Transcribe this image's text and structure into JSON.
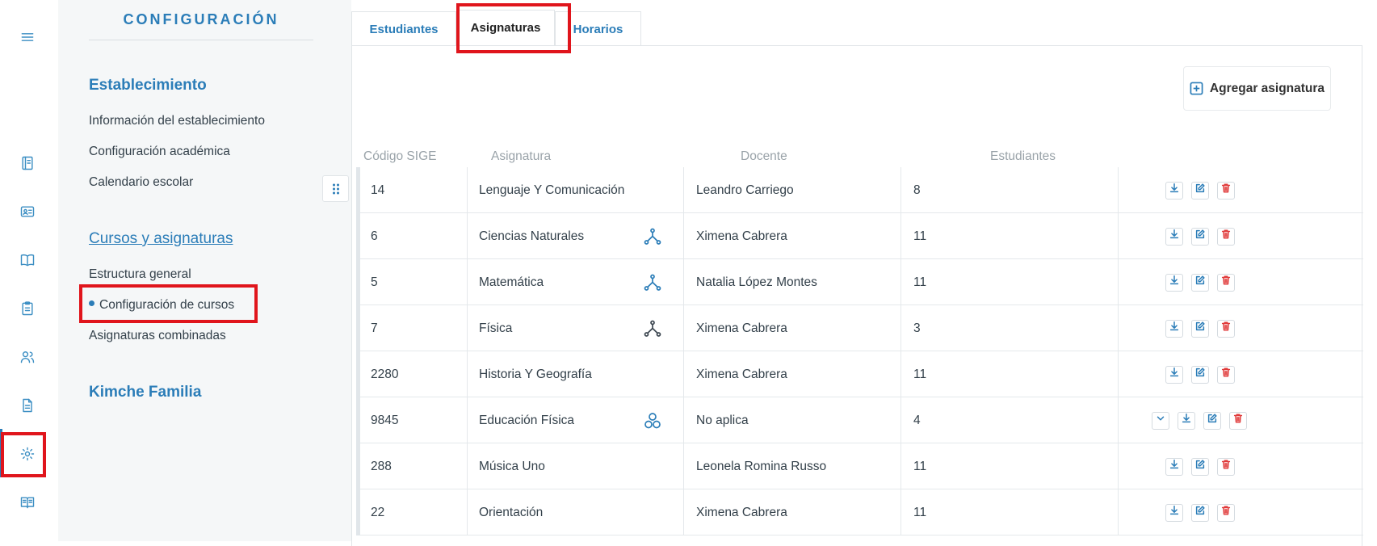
{
  "config": {
    "title": "CONFIGURACIÓN",
    "sections": [
      {
        "title": "Establecimiento",
        "items": [
          "Información del establecimiento",
          "Configuración académica",
          "Calendario escolar"
        ]
      },
      {
        "title": "Cursos y asignaturas",
        "items": [
          "Estructura general",
          "Configuración de cursos",
          "Asignaturas combinadas"
        ]
      },
      {
        "title": "Kimche Familia",
        "items": []
      }
    ]
  },
  "tabs": [
    "Estudiantes",
    "Asignaturas",
    "Horarios"
  ],
  "active_tab": "Asignaturas",
  "add_button": "Agregar asignatura",
  "table": {
    "headers": [
      "Código SIGE",
      "Asignatura",
      "Docente",
      "Estudiantes"
    ],
    "rows": [
      {
        "code": "14",
        "subject": "Lenguaje Y Comunicación",
        "teacher": "Leandro Carriego",
        "students": "8",
        "icon": ""
      },
      {
        "code": "6",
        "subject": "Ciencias Naturales",
        "teacher": "Ximena Cabrera",
        "students": "11",
        "icon": "tree-icon"
      },
      {
        "code": "5",
        "subject": "Matemática",
        "teacher": "Natalia López Montes",
        "students": "11",
        "icon": "tree-icon"
      },
      {
        "code": "7",
        "subject": "Física",
        "teacher": "Ximena Cabrera",
        "students": "3",
        "icon": "tree-icon-dark"
      },
      {
        "code": "2280",
        "subject": "Historia Y Geografía",
        "teacher": "Ximena Cabrera",
        "students": "11",
        "icon": ""
      },
      {
        "code": "9845",
        "subject": "Educación Física",
        "teacher": "No aplica",
        "students": "4",
        "icon": "group-icon"
      },
      {
        "code": "288",
        "subject": "Música Uno",
        "teacher": "Leonela Romina Russo",
        "students": "11",
        "icon": ""
      },
      {
        "code": "22",
        "subject": "Orientación",
        "teacher": "Ximena Cabrera",
        "students": "11",
        "icon": ""
      }
    ]
  },
  "colors": {
    "accent": "#2b7db8",
    "highlight": "#e0151c",
    "danger": "#e03a3a"
  }
}
